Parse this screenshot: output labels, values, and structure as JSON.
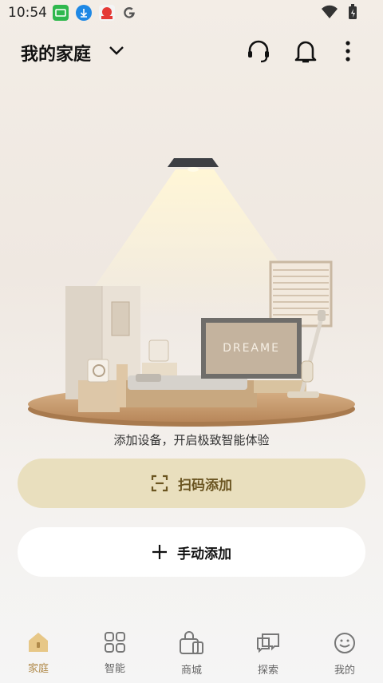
{
  "status_bar": {
    "time": "10:54"
  },
  "header": {
    "title": "我的家庭"
  },
  "illustration": {
    "brand": "DREAME"
  },
  "empty_state": {
    "subtitle": "添加设备，开启极致智能体验"
  },
  "actions": {
    "scan_label": "扫码添加",
    "manual_label": "手动添加"
  },
  "tabbar": {
    "tabs": [
      {
        "label": "家庭",
        "icon": "home-icon"
      },
      {
        "label": "智能",
        "icon": "grid-icon"
      },
      {
        "label": "商城",
        "icon": "shopping-bag-icon"
      },
      {
        "label": "探索",
        "icon": "chat-bubbles-icon"
      },
      {
        "label": "我的",
        "icon": "face-icon"
      }
    ]
  },
  "colors": {
    "accent": "#b08a4a",
    "scan_button_bg": "#e9dfbe"
  }
}
